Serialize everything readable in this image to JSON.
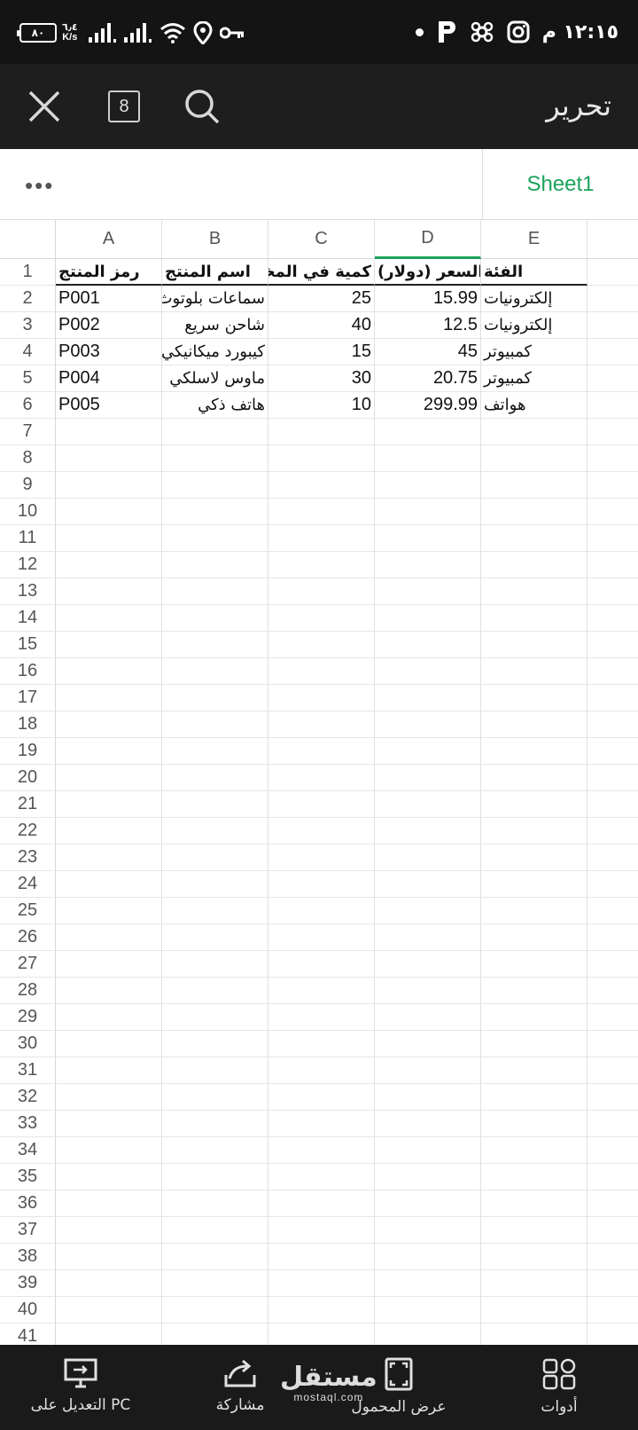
{
  "status_bar": {
    "battery": "٨٠",
    "speed_value": "٦٫٤",
    "speed_unit": "K/s",
    "time": "١٢:١٥ م"
  },
  "app_bar": {
    "title": "تحرير",
    "tab_count": "8",
    "icons": [
      "close-icon",
      "tabs-icon",
      "search-icon"
    ]
  },
  "sheet_bar": {
    "more": "•••",
    "active_sheet": "Sheet1"
  },
  "spreadsheet": {
    "columns": [
      "A",
      "B",
      "C",
      "D",
      "E"
    ],
    "active_column": "D",
    "header": {
      "A": "رمز المنتج",
      "B": "اسم المنتج",
      "C": "كمية في المخزون",
      "D": "السعر (دولار)",
      "E": "الفئة"
    },
    "rows": [
      {
        "A": "P001",
        "B": "سماعات بلوتوث",
        "C": "25",
        "D": "15.99",
        "E": "إلكترونيات"
      },
      {
        "A": "P002",
        "B": "شاحن سريع",
        "C": "40",
        "D": "12.5",
        "E": "إلكترونيات"
      },
      {
        "A": "P003",
        "B": "كيبورد ميكانيكي",
        "C": "15",
        "D": "45",
        "E": "كمبيوتر"
      },
      {
        "A": "P004",
        "B": "ماوس لاسلكي",
        "C": "30",
        "D": "20.75",
        "E": "كمبيوتر"
      },
      {
        "A": "P005",
        "B": "هاتف ذكي",
        "C": "10",
        "D": "299.99",
        "E": "هواتف"
      }
    ],
    "visible_row_count": 41
  },
  "bottom_bar": {
    "edit_pc": "التعديل على PC",
    "share": "مشاركة",
    "mobile_view": "عرض المحمول",
    "tools": "أدوات",
    "watermark_main": "مستقل",
    "watermark_sub": "mostaql.com"
  }
}
